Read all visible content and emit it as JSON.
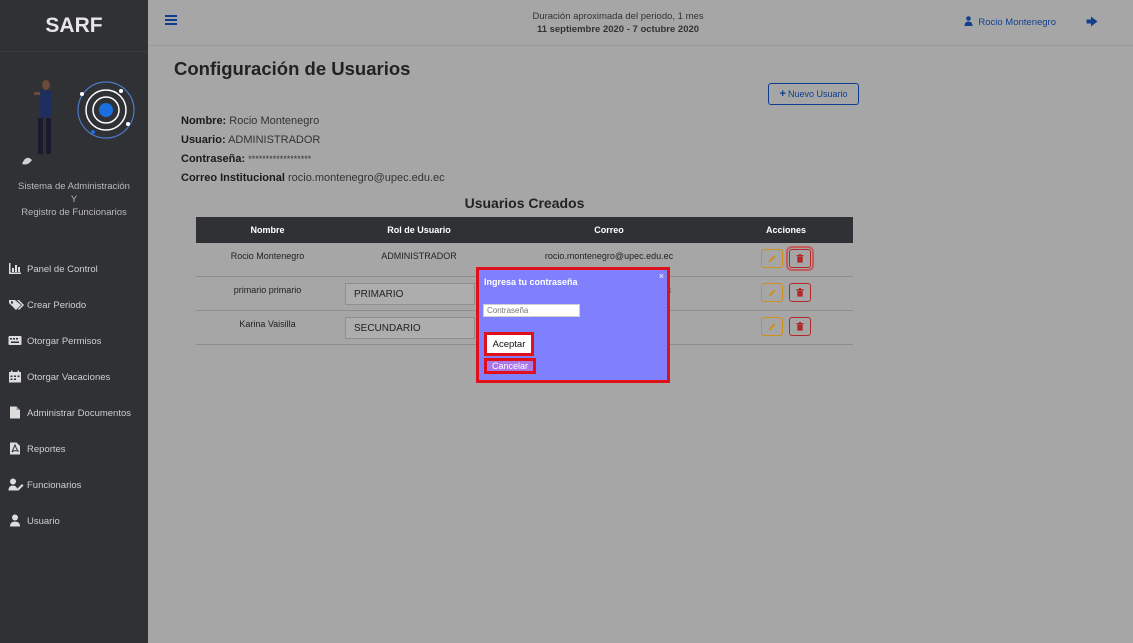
{
  "sidebar": {
    "brand": "SARF",
    "system_title_line1": "Sistema de Administración",
    "system_title_line2": "Y",
    "system_title_line3": "Registro de Funcionarios",
    "items": [
      {
        "label": "Panel de Control",
        "icon": "chart-icon"
      },
      {
        "label": "Crear Periodo",
        "icon": "tags-icon"
      },
      {
        "label": "Otorgar Permisos",
        "icon": "keyboard-icon"
      },
      {
        "label": "Otorgar Vacaciones",
        "icon": "calendar-icon"
      },
      {
        "label": "Administrar Documentos",
        "icon": "file-icon"
      },
      {
        "label": "Reportes",
        "icon": "pdf-file-icon"
      },
      {
        "label": "Funcionarios",
        "icon": "user-edit-icon"
      },
      {
        "label": "Usuario",
        "icon": "user-icon"
      }
    ]
  },
  "topbar": {
    "period_line1": "Duración aproximada del periodo, 1 mes",
    "period_line2": "11 septiembre 2020 - 7 octubre 2020",
    "user_name": "Rocio Montenegro"
  },
  "main": {
    "title": "Configuración de Usuarios",
    "new_user_label": "Nuevo Usuario",
    "profile": {
      "name_label": "Nombre:",
      "name_value": "Rocio Montenegro",
      "user_label": "Usuario:",
      "user_value": "ADMINISTRADOR",
      "password_label": "Contraseña:",
      "password_value": "******************",
      "email_label": "Correo Institucional",
      "email_value": "rocio.montenegro@upec.edu.ec"
    },
    "table_title": "Usuarios Creados",
    "columns": [
      "Nombre",
      "Rol de Usuario",
      "Correo",
      "Acciones"
    ],
    "rows": [
      {
        "nombre": "Rocio Montenegro",
        "rol": "ADMINISTRADOR",
        "correo": "rocio.montenegro@upec.edu.ec"
      },
      {
        "nombre": "primario primario",
        "rol": "PRIMARIO",
        "correo": "ec"
      },
      {
        "nombre": "Karina Vaisilla",
        "rol": "SECUNDARIO",
        "correo": ""
      }
    ]
  },
  "modal": {
    "title": "Ingresa tu contraseña",
    "close": "×",
    "input_placeholder": "Contraseña",
    "accept_label": "Aceptar",
    "cancel_label": "Cancelar"
  },
  "colors": {
    "sidebar_bg": "#2f3135",
    "accent": "#0e3d8f",
    "modal_bg": "#8080ff",
    "highlight": "#e0101a"
  }
}
